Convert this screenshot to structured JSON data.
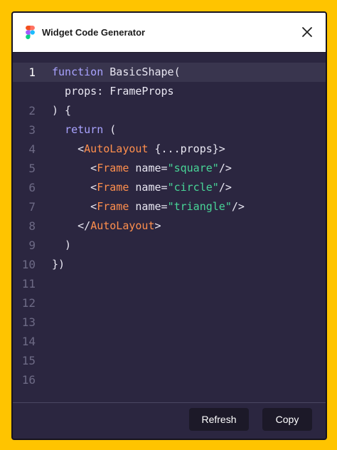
{
  "window": {
    "title": "Widget Code Generator"
  },
  "editor": {
    "active_line": "1",
    "lines": [
      {
        "num": "1",
        "tokens": [
          {
            "t": "function",
            "c": "kw"
          },
          {
            "t": " BasicShape(",
            "c": ""
          }
        ]
      },
      {
        "num": "",
        "tokens": [
          {
            "t": "  props: FrameProps",
            "c": ""
          }
        ]
      },
      {
        "num": "2",
        "tokens": [
          {
            "t": ") {",
            "c": ""
          }
        ]
      },
      {
        "num": "3",
        "tokens": [
          {
            "t": "  ",
            "c": ""
          },
          {
            "t": "return",
            "c": "kw"
          },
          {
            "t": " (",
            "c": ""
          }
        ]
      },
      {
        "num": "4",
        "tokens": [
          {
            "t": "    <",
            "c": ""
          },
          {
            "t": "AutoLayout",
            "c": "tag"
          },
          {
            "t": " {...props}>",
            "c": ""
          }
        ]
      },
      {
        "num": "5",
        "tokens": [
          {
            "t": "      <",
            "c": ""
          },
          {
            "t": "Frame",
            "c": "tag"
          },
          {
            "t": " name=",
            "c": ""
          },
          {
            "t": "\"square\"",
            "c": "str"
          },
          {
            "t": "/>",
            "c": ""
          }
        ]
      },
      {
        "num": "6",
        "tokens": [
          {
            "t": "      <",
            "c": ""
          },
          {
            "t": "Frame",
            "c": "tag"
          },
          {
            "t": " name=",
            "c": ""
          },
          {
            "t": "\"circle\"",
            "c": "str"
          },
          {
            "t": "/>",
            "c": ""
          }
        ]
      },
      {
        "num": "7",
        "tokens": [
          {
            "t": "      <",
            "c": ""
          },
          {
            "t": "Frame",
            "c": "tag"
          },
          {
            "t": " name=",
            "c": ""
          },
          {
            "t": "\"triangle\"",
            "c": "str"
          },
          {
            "t": "/>",
            "c": ""
          }
        ]
      },
      {
        "num": "8",
        "tokens": [
          {
            "t": "    </",
            "c": ""
          },
          {
            "t": "AutoLayout",
            "c": "tag"
          },
          {
            "t": ">",
            "c": ""
          }
        ]
      },
      {
        "num": "9",
        "tokens": [
          {
            "t": "  )",
            "c": ""
          }
        ]
      },
      {
        "num": "10",
        "tokens": [
          {
            "t": "})",
            "c": ""
          }
        ]
      },
      {
        "num": "11",
        "tokens": []
      },
      {
        "num": "12",
        "tokens": []
      },
      {
        "num": "13",
        "tokens": []
      },
      {
        "num": "14",
        "tokens": []
      },
      {
        "num": "15",
        "tokens": []
      },
      {
        "num": "16",
        "tokens": []
      }
    ]
  },
  "footer": {
    "refresh_label": "Refresh",
    "copy_label": "Copy"
  },
  "colors": {
    "background": "#FFC400",
    "editor_bg": "#2B2640",
    "keyword": "#A9A3FF",
    "tag": "#FF8F4D",
    "string": "#48D597"
  },
  "icons": {
    "app": "figma-logo-icon",
    "close": "close-icon"
  }
}
